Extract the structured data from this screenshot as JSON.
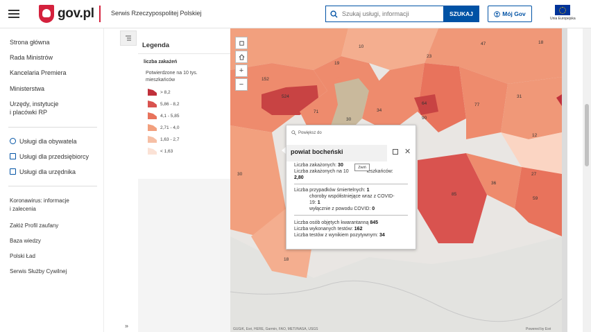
{
  "header": {
    "logo_text": "gov.pl",
    "service_name": "Serwis Rzeczypospolitej Polskiej",
    "search_placeholder": "Szukaj usługi, informacji",
    "search_button": "SZUKAJ",
    "login_button": "Mój Gov",
    "eu_label": "Unia Europejska"
  },
  "sidebar": {
    "items": [
      "Strona główna",
      "Rada Ministrów",
      "Kancelaria Premiera",
      "Ministerstwa",
      "Urzędy, instytucje",
      "i placówki RP"
    ],
    "services": [
      "Usługi dla obywatela",
      "Usługi dla przedsiębiorcy",
      "Usługi dla urzędnika"
    ],
    "links": [
      "Koronawirus: informacje",
      "i zalecenia",
      "Załóż Profil zaufany",
      "Baza wiedzy",
      "Polski Ład",
      "Serwis Służby Cywilnej"
    ],
    "collapse": "»"
  },
  "legend": {
    "title": "Legenda",
    "layer": "liczba zakażeń",
    "description": "Potwierdzone na 10 tys. mieszkańców",
    "classes": [
      {
        "label": "> 8,2",
        "color": "#c0303b"
      },
      {
        "label": "5,86 - 8,2",
        "color": "#d9534f"
      },
      {
        "label": "4,1 - 5,85",
        "color": "#e8735c"
      },
      {
        "label": "2,71 - 4,0",
        "color": "#f2a07e"
      },
      {
        "label": "1,63 - 2,7",
        "color": "#f6bfa5"
      },
      {
        "label": "< 1,63",
        "color": "#fbe2d6"
      }
    ]
  },
  "map": {
    "labels": [
      "10",
      "47",
      "18",
      "23",
      "152",
      "19",
      "524",
      "71",
      "30",
      "34",
      "64",
      "77",
      "31",
      "90",
      "12",
      "30",
      "36",
      "27",
      "85",
      "59",
      "18"
    ],
    "attribution": "GUGiK, Esri, HERE, Garmin, FAO, METI/NASA, USGS",
    "powered_by": "Powered by Esri"
  },
  "popup": {
    "zoom_to": "Powiększ do",
    "title": "powiat bocheński",
    "tooltip": "Zwiń",
    "l1_label": "Liczba zakażonych:",
    "l1_value": "30",
    "l2_label": "Liczba zakażonych na 10",
    "l2_tail": "ieszkańców:",
    "l2_value": "2,80",
    "l3_label": "Liczba przypadków śmiertelnych:",
    "l3_value": "1",
    "l4": "choroby współistniejące wraz z COVID-",
    "l5_label": "19:",
    "l5_value": "1",
    "l6_label": "wyłącznie z powodu COVID:",
    "l6_value": "0",
    "l7_label": "Liczba osób objętych kwarantanną",
    "l7_value": "845",
    "l8_label": "Liczba wykonanych testów:",
    "l8_value": "162",
    "l9_label": "Liczba testów z wynikiem pozytywnym:",
    "l9_value": "34"
  }
}
